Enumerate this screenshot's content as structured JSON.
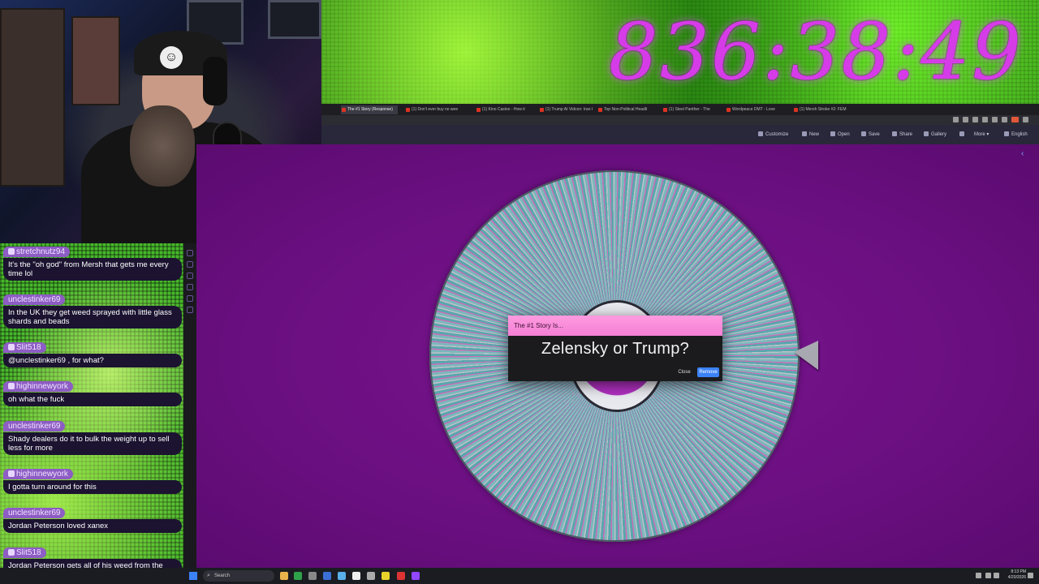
{
  "stream_timer": "836:38:49",
  "chat": {
    "messages": [
      {
        "user": "stretchnutz94",
        "text": "It's the \"oh god\" from Mersh that gets me every time lol"
      },
      {
        "user": "unclestinker69",
        "text": "In the UK they get weed sprayed with little glass shards and beads"
      },
      {
        "user": "Slit518",
        "text": "@unclestinker69 , for what?"
      },
      {
        "user": "highinnewyork",
        "text": "oh what the fuck"
      },
      {
        "user": "unclestinker69",
        "text": "Shady dealers do it to bulk the weight up to sell less for more"
      },
      {
        "user": "highinnewyork",
        "text": "I gotta turn around for this"
      },
      {
        "user": "unclestinker69",
        "text": "Jordan Peterson loved xanex"
      },
      {
        "user": "Slit518",
        "text": "Jordan Peterson gets all of his weed from the gas station"
      }
    ]
  },
  "browser": {
    "tabs": [
      "The #1 Story (Response)",
      "(1) Don't ever buy no wee",
      "(1) Kino Casino - How it",
      "(1) Trump At Vidcon: Iran G",
      "Top Non-Political Headli",
      "(1) Steel Panther - The",
      "Wordpeace DMT - Love",
      "(1) Mersh Stroke #2: FEM"
    ],
    "app_toolbar": {
      "customize": "Customize",
      "new": "New",
      "open": "Open",
      "save": "Save",
      "share": "Share",
      "gallery": "Gallery",
      "more": "More",
      "language": "English"
    }
  },
  "dialog": {
    "title": "The #1 Story Is...",
    "result": "Zelensky or Trump?",
    "close_label": "Close",
    "remove_label": "Remove"
  },
  "taskbar": {
    "search_placeholder": "Search",
    "time": "8:13 PM",
    "date": "4/20/2026"
  },
  "colors": {
    "timer": "#d63be8",
    "dialog_header": "#f47fd5",
    "remove_button": "#3b82f6",
    "background": "#6a0f80"
  }
}
